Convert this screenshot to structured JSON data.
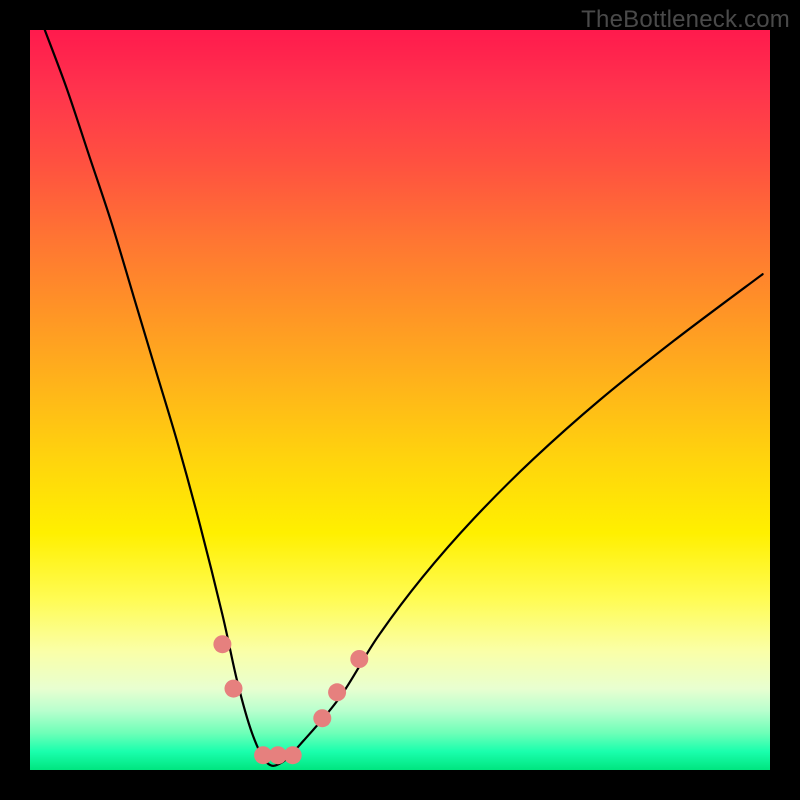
{
  "watermark": "TheBottleneck.com",
  "chart_data": {
    "type": "line",
    "title": "",
    "xlabel": "",
    "ylabel": "",
    "xrange": [
      0,
      100
    ],
    "yrange": [
      0,
      100
    ],
    "gradient_stops": [
      {
        "pct": 0,
        "color": "#ff1a4d"
      },
      {
        "pct": 50,
        "color": "#ffd000"
      },
      {
        "pct": 85,
        "color": "#fbffb0"
      },
      {
        "pct": 100,
        "color": "#00e57f"
      }
    ],
    "series": [
      {
        "name": "bottleneck-curve",
        "x": [
          2,
          5,
          8,
          11,
          14,
          17,
          20,
          23,
          26,
          28,
          30,
          32,
          34,
          37,
          42,
          47,
          53,
          60,
          68,
          77,
          87,
          99
        ],
        "y": [
          100,
          92,
          83,
          74,
          64,
          54,
          44,
          33,
          21,
          12,
          5,
          1,
          1,
          4,
          10,
          18,
          26,
          34,
          42,
          50,
          58,
          67
        ]
      }
    ],
    "markers": [
      {
        "x": 26.0,
        "y": 17.0
      },
      {
        "x": 27.5,
        "y": 11.0
      },
      {
        "x": 31.5,
        "y": 2.0
      },
      {
        "x": 33.5,
        "y": 2.0
      },
      {
        "x": 35.5,
        "y": 2.0
      },
      {
        "x": 39.5,
        "y": 7.0
      },
      {
        "x": 41.5,
        "y": 10.5
      },
      {
        "x": 44.5,
        "y": 15.0
      }
    ],
    "marker_style": {
      "color": "#e6807e",
      "radius_px": 9
    }
  }
}
